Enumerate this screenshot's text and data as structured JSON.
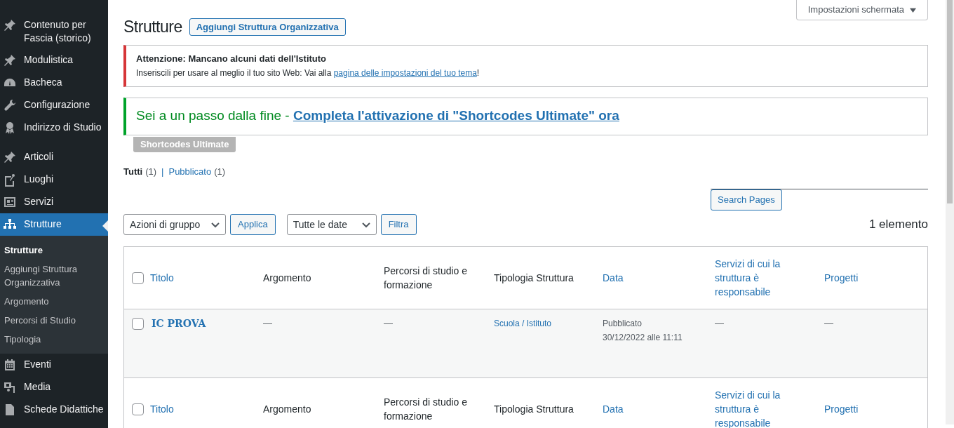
{
  "sidebar": {
    "groups": [
      [
        {
          "label": "Contenuto per Fascia (storico)",
          "selected": false
        },
        {
          "label": "Modulistica",
          "selected": false
        },
        {
          "label": "Bacheca",
          "selected": false
        },
        {
          "label": "Configurazione",
          "selected": false
        },
        {
          "label": "Indirizzo di Studio",
          "selected": false
        }
      ],
      [
        {
          "label": "Articoli",
          "selected": false
        },
        {
          "label": "Luoghi",
          "selected": false
        },
        {
          "label": "Servizi",
          "selected": false
        },
        {
          "label": "Strutture",
          "selected": true,
          "submenu": [
            {
              "label": "Strutture",
              "selected": true
            },
            {
              "label": "Aggiungi Struttura Organizzativa",
              "selected": false
            },
            {
              "label": "Argomento",
              "selected": false
            },
            {
              "label": "Percorsi di Studio",
              "selected": false
            },
            {
              "label": "Tipologia",
              "selected": false
            }
          ]
        },
        {
          "label": "Eventi",
          "selected": false
        },
        {
          "label": "Media",
          "selected": false
        },
        {
          "label": "Schede Didattiche",
          "selected": false
        }
      ]
    ]
  },
  "screen_options": "Impostazioni schermata",
  "page_title": "Strutture",
  "add_button": "Aggiungi Struttura Organizzativa",
  "notice_error": {
    "title": "Attenzione: Mancano alcuni dati dell'Istituto",
    "text": "Inseriscili per usare al meglio il tuo sito Web: Vai alla ",
    "link": "pagina delle impostazioni del tuo tema",
    "after": "!"
  },
  "notice_success": {
    "text": "Sei a un passo dalla fine - ",
    "link": "Completa l'attivazione di \"Shortcodes Ultimate\" ora",
    "tag": "Shortcodes Ultimate"
  },
  "views": [
    {
      "label": "Tutti",
      "count": "(1)",
      "selected": true
    },
    {
      "label": "Pubblicato",
      "count": "(1)",
      "selected": false
    }
  ],
  "views_separator": "|",
  "search_button": "Search Pages",
  "bulk_select": "Azioni di gruppo",
  "apply_button": "Applica",
  "date_select": "Tutte le date",
  "filter_button": "Filtra",
  "items_count": "1 elemento",
  "table": {
    "select_all_checked": false,
    "columns": [
      {
        "label": "Titolo",
        "kind": "sortable"
      },
      {
        "label": "Argomento",
        "kind": "plain"
      },
      {
        "label": "Percorsi di studio e formazione",
        "kind": "plain"
      },
      {
        "label": "Tipologia Struttura",
        "kind": "plain"
      },
      {
        "label": "Data",
        "kind": "sortable"
      },
      {
        "label": "Servizi di cui la struttura è responsabile",
        "kind": "sortable"
      },
      {
        "label": "Progetti",
        "kind": "sortable"
      }
    ],
    "footer_select_all_checked": false,
    "footer_columns": [
      {
        "label": "Titolo",
        "kind": "sortable"
      },
      {
        "label": "Argomento",
        "kind": "plain"
      },
      {
        "label": "Percorsi di studio e formazione",
        "kind": "plain"
      },
      {
        "label": "Tipologia Struttura",
        "kind": "plain"
      },
      {
        "label": "Data",
        "kind": "sortable"
      },
      {
        "label": "Servizi di cui la struttura è responsabile",
        "kind": "sortable"
      },
      {
        "label": "Progetti",
        "kind": "sortable"
      }
    ],
    "rows": [
      {
        "checked": false,
        "cells": [
          "IC PROVA",
          "—",
          "—",
          "Scuola / Istituto",
          "Pubblicato\n30/12/2022 alle 11:11",
          "—",
          "—"
        ]
      }
    ]
  }
}
